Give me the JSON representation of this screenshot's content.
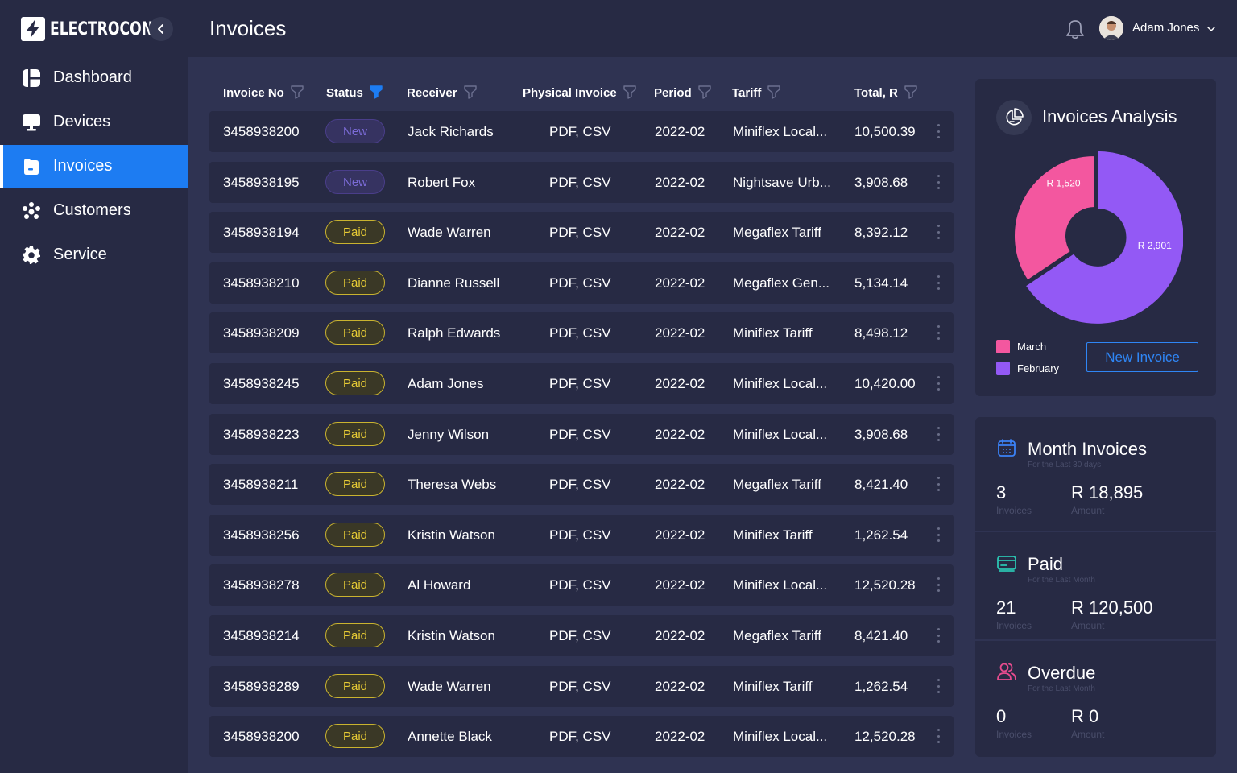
{
  "app": {
    "brand": "ELECTROCON"
  },
  "sidebar": {
    "items": [
      {
        "label": "Dashboard",
        "icon": "dashboard-icon",
        "active": false
      },
      {
        "label": "Devices",
        "icon": "monitor-icon",
        "active": false
      },
      {
        "label": "Invoices",
        "icon": "invoice-icon",
        "active": true
      },
      {
        "label": "Customers",
        "icon": "customers-icon",
        "active": false
      },
      {
        "label": "Service",
        "icon": "gear-icon",
        "active": false
      }
    ]
  },
  "header": {
    "title": "Invoices",
    "user_name": "Adam Jones"
  },
  "table": {
    "columns": [
      "Invoice No",
      "Status",
      "Receiver",
      "Physical Invoice",
      "Period",
      "Tariff",
      "Total, R"
    ],
    "rows": [
      {
        "invoice_no": "3458938200",
        "status": "New",
        "receiver": "Jack Richards",
        "physical": "PDF, CSV",
        "period": "2022-02",
        "tariff": "Miniflex Local...",
        "total": "10,500.39"
      },
      {
        "invoice_no": "3458938195",
        "status": "New",
        "receiver": "Robert Fox",
        "physical": "PDF, CSV",
        "period": "2022-02",
        "tariff": "Nightsave Urb...",
        "total": "3,908.68"
      },
      {
        "invoice_no": "3458938194",
        "status": "Paid",
        "receiver": "Wade Warren",
        "physical": "PDF, CSV",
        "period": "2022-02",
        "tariff": "Megaflex Tariff",
        "total": "8,392.12"
      },
      {
        "invoice_no": "3458938210",
        "status": "Paid",
        "receiver": "Dianne Russell",
        "physical": "PDF, CSV",
        "period": "2022-02",
        "tariff": "Megaflex Gen...",
        "total": "5,134.14"
      },
      {
        "invoice_no": "3458938209",
        "status": "Paid",
        "receiver": "Ralph Edwards",
        "physical": "PDF, CSV",
        "period": "2022-02",
        "tariff": "Miniflex Tariff",
        "total": "8,498.12"
      },
      {
        "invoice_no": "3458938245",
        "status": "Paid",
        "receiver": "Adam Jones",
        "physical": "PDF, CSV",
        "period": "2022-02",
        "tariff": "Miniflex Local...",
        "total": "10,420.00"
      },
      {
        "invoice_no": "3458938223",
        "status": "Paid",
        "receiver": "Jenny Wilson",
        "physical": "PDF, CSV",
        "period": "2022-02",
        "tariff": "Miniflex Local...",
        "total": "3,908.68"
      },
      {
        "invoice_no": "3458938211",
        "status": "Paid",
        "receiver": "Theresa Webs",
        "physical": "PDF, CSV",
        "period": "2022-02",
        "tariff": "Megaflex Tariff",
        "total": "8,421.40"
      },
      {
        "invoice_no": "3458938256",
        "status": "Paid",
        "receiver": "Kristin Watson",
        "physical": "PDF, CSV",
        "period": "2022-02",
        "tariff": "Miniflex Tariff",
        "total": "1,262.54"
      },
      {
        "invoice_no": "3458938278",
        "status": "Paid",
        "receiver": "Al Howard",
        "physical": "PDF, CSV",
        "period": "2022-02",
        "tariff": "Miniflex Local...",
        "total": "12,520.28"
      },
      {
        "invoice_no": "3458938214",
        "status": "Paid",
        "receiver": "Kristin Watson",
        "physical": "PDF, CSV",
        "period": "2022-02",
        "tariff": "Megaflex Tariff",
        "total": "8,421.40"
      },
      {
        "invoice_no": "3458938289",
        "status": "Paid",
        "receiver": "Wade Warren",
        "physical": "PDF, CSV",
        "period": "2022-02",
        "tariff": "Miniflex Tariff",
        "total": "1,262.54"
      },
      {
        "invoice_no": "3458938200",
        "status": "Paid",
        "receiver": "Annette Black",
        "physical": "PDF, CSV",
        "period": "2022-02",
        "tariff": "Miniflex Local...",
        "total": "12,520.28"
      }
    ]
  },
  "analysis": {
    "title": "Invoices Analysis",
    "new_invoice_label": "New Invoice",
    "chart_data": {
      "type": "pie",
      "donut": true,
      "categories": [
        "March",
        "February"
      ],
      "values": [
        1520,
        2901
      ],
      "data_labels": [
        "R 1,520",
        "R 2,901"
      ],
      "colors": [
        "#f3579f",
        "#9359f5"
      ],
      "legend_position": "bottom-left"
    }
  },
  "stats": [
    {
      "title": "Month Invoices",
      "subtitle": "For the Last 30 days",
      "count": "3",
      "count_label": "Invoices",
      "amount": "R 18,895",
      "amount_label": "Amount",
      "icon": "calendar-icon",
      "color": "#3b82f6"
    },
    {
      "title": "Paid",
      "subtitle": "For the Last Month",
      "count": "21",
      "count_label": "Invoices",
      "amount": "R 120,500",
      "amount_label": "Amount",
      "icon": "card-icon",
      "color": "#2bc4b1"
    },
    {
      "title": "Overdue",
      "subtitle": "For the Last Month",
      "count": "0",
      "count_label": "Invoices",
      "amount": "R 0",
      "amount_label": "Amount",
      "icon": "users-icon",
      "color": "#e84c8f"
    }
  ],
  "colors": {
    "accent": "#1d7cf2",
    "new_badge": "#7b6bd6",
    "paid_badge": "#e8cc35"
  }
}
